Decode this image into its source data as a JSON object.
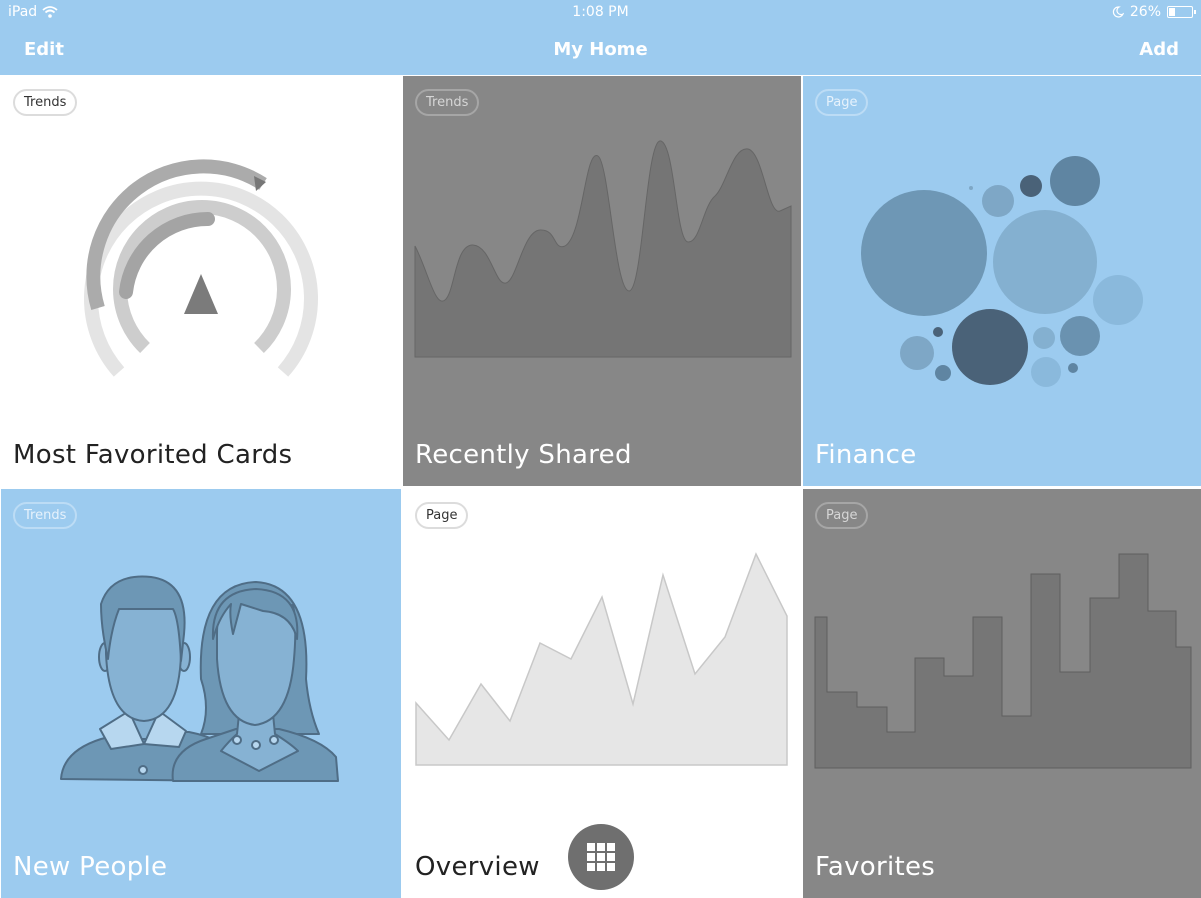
{
  "status_bar": {
    "carrier": "iPad",
    "time": "1:08 PM",
    "battery_text": "26%",
    "battery_level": 0.26,
    "icons": [
      "wifi-icon",
      "moon-icon",
      "battery-icon"
    ]
  },
  "nav": {
    "edit_label": "Edit",
    "title": "My Home",
    "add_label": "Add"
  },
  "colors": {
    "accent_blue": "#9ccbef",
    "tile_grey": "#878787",
    "tile_white": "#ffffff"
  },
  "tiles": [
    {
      "badge": "Trends",
      "title": "Most Favorited Cards",
      "style": "white",
      "illustration": "gauge-chart"
    },
    {
      "badge": "Trends",
      "title": "Recently Shared",
      "style": "grey",
      "illustration": "wave-area-chart"
    },
    {
      "badge": "Page",
      "title": "Finance",
      "style": "blue",
      "illustration": "bubble-chart"
    },
    {
      "badge": "Trends",
      "title": "New People",
      "style": "blue",
      "illustration": "people-icon"
    },
    {
      "badge": "Page",
      "title": "Overview",
      "style": "white",
      "illustration": "line-area-chart"
    },
    {
      "badge": "Page",
      "title": "Favorites",
      "style": "grey",
      "illustration": "step-area-chart"
    }
  ],
  "fab": {
    "icon": "grid-icon"
  }
}
